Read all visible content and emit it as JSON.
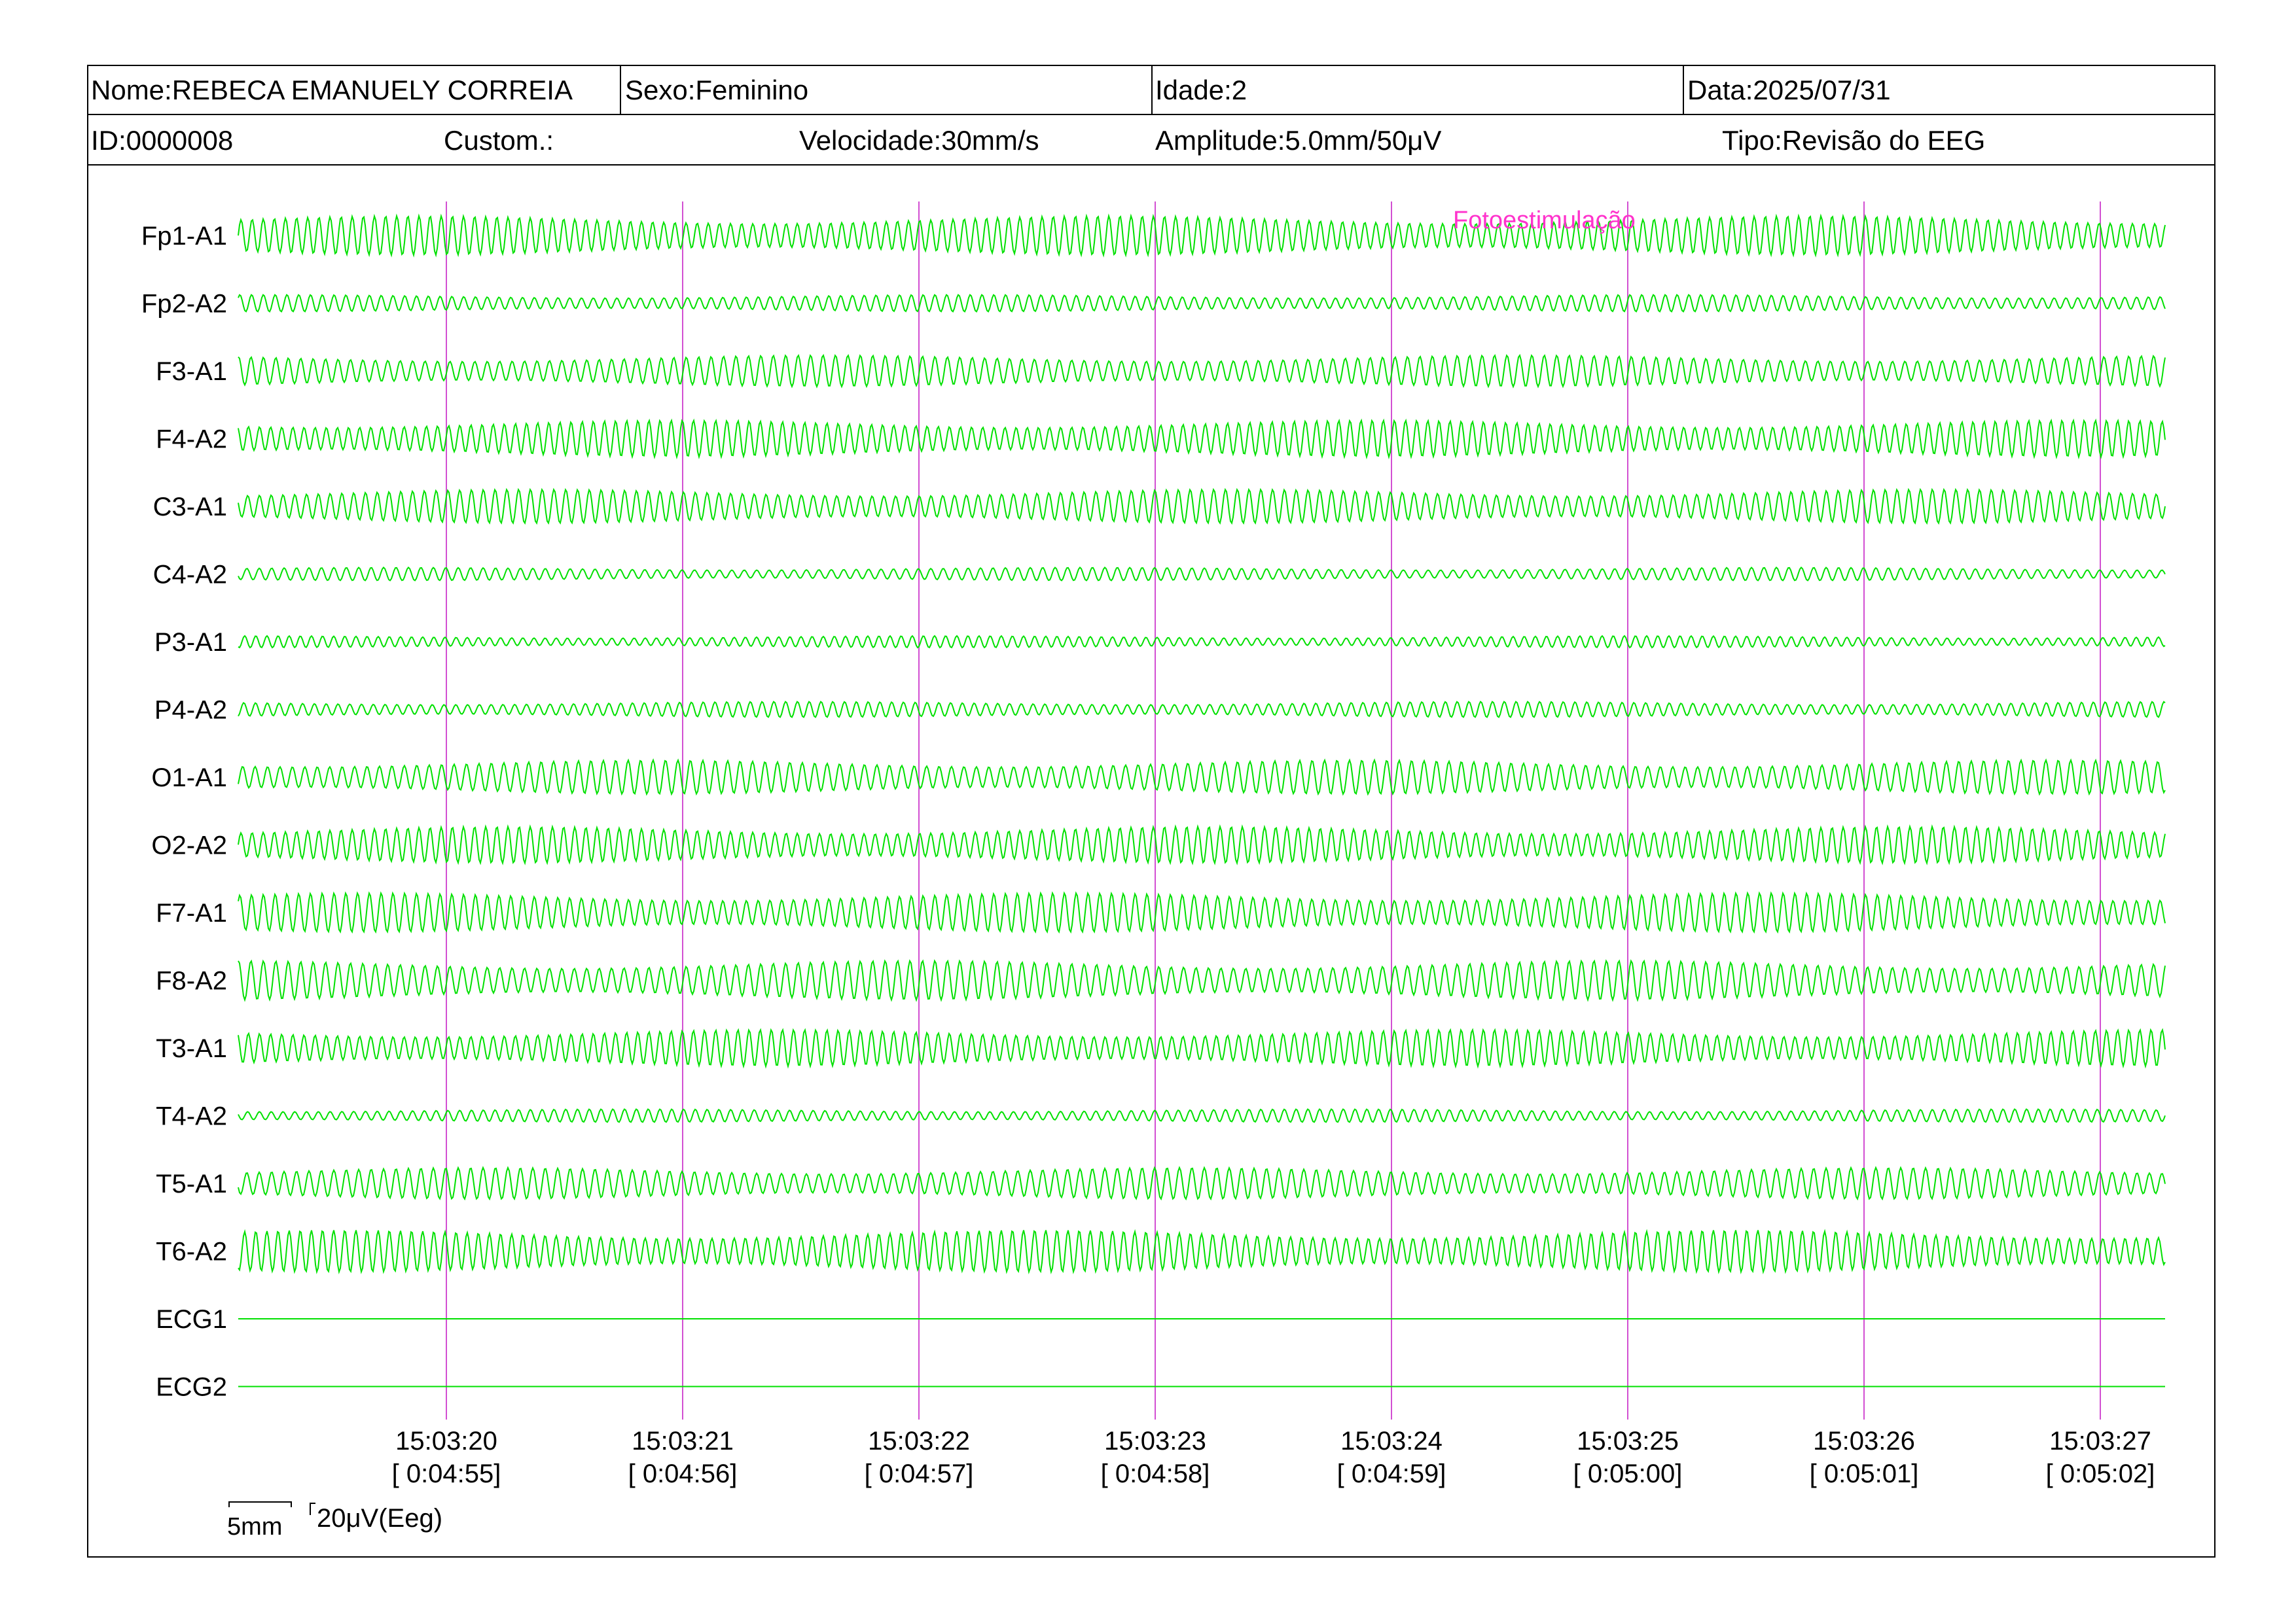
{
  "header": {
    "name": "Nome:REBECA EMANUELY CORREIA",
    "sex": "Sexo:Feminino",
    "age": "Idade:2",
    "date": "Data:2025/07/31",
    "id": "ID:0000008",
    "custom": "Custom.:",
    "speed": "Velocidade:30mm/s",
    "amplitude": "Amplitude:5.0mm/50μV",
    "type": "Tipo:Revisão do EEG"
  },
  "annotation": {
    "label": "Fotoestimulação",
    "color": "#ff33cc"
  },
  "scale": {
    "time_label": "5mm",
    "amp_label": "20μV(Eeg)"
  },
  "colors": {
    "trace": "#00e000",
    "marker": "#d24fd2"
  },
  "chart_data": {
    "type": "line",
    "channels": [
      "Fp1-A1",
      "Fp2-A2",
      "F3-A1",
      "F4-A2",
      "C3-A1",
      "C4-A2",
      "P3-A1",
      "P4-A2",
      "O1-A1",
      "O2-A2",
      "F7-A1",
      "F8-A2",
      "T3-A1",
      "T4-A2",
      "T5-A1",
      "T6-A2",
      "ECG1",
      "ECG2"
    ],
    "flat_channels": [
      "ECG1",
      "ECG2"
    ],
    "time_markers": [
      {
        "clock": "15:03:20",
        "elapsed": "[ 0:04:55]"
      },
      {
        "clock": "15:03:21",
        "elapsed": "[ 0:04:56]"
      },
      {
        "clock": "15:03:22",
        "elapsed": "[ 0:04:57]"
      },
      {
        "clock": "15:03:23",
        "elapsed": "[ 0:04:58]"
      },
      {
        "clock": "15:03:24",
        "elapsed": "[ 0:04:59]"
      },
      {
        "clock": "15:03:25",
        "elapsed": "[ 0:05:00]"
      },
      {
        "clock": "15:03:26",
        "elapsed": "[ 0:05:01]"
      },
      {
        "clock": "15:03:27",
        "elapsed": "[ 0:05:02]"
      }
    ]
  }
}
